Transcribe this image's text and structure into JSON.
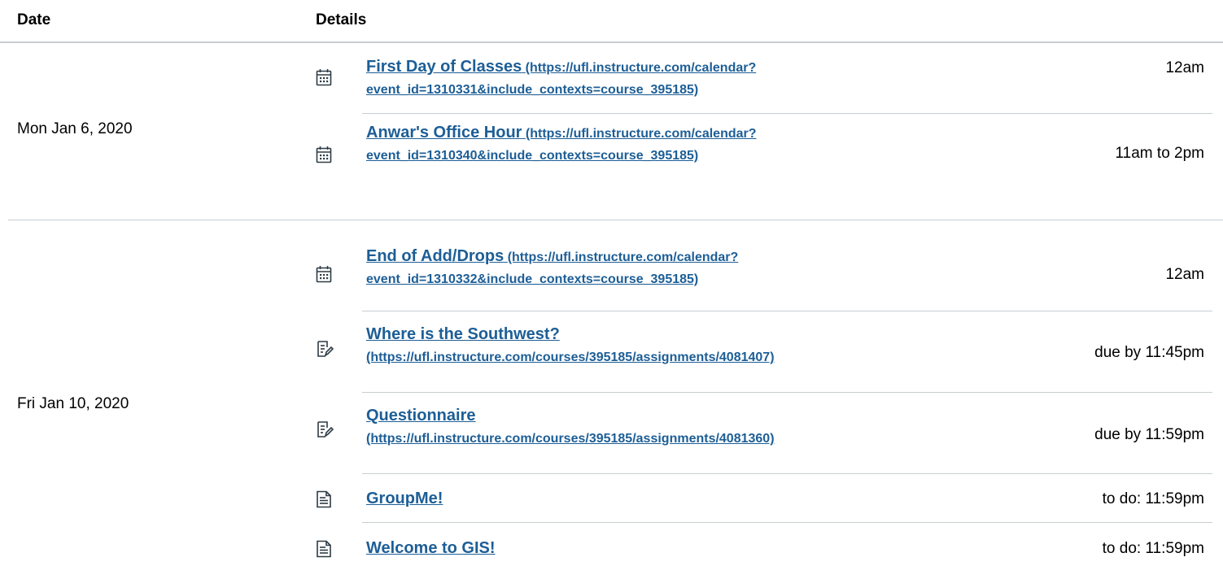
{
  "header": {
    "date_label": "Date",
    "details_label": "Details"
  },
  "groups": [
    {
      "date": "Mon Jan 6, 2020",
      "events": [
        {
          "icon": "calendar-icon",
          "title": "First Day of Classes",
          "url": "(https://ufl.instructure.com/calendar?event_id=1310331&include_contexts=course_395185)",
          "url_line1": "(https://ufl.instructure.com/calendar?",
          "url_line2": "event_id=1310331&include_contexts=course_395185)",
          "time": "12am"
        },
        {
          "icon": "calendar-icon",
          "title": "Anwar's Office Hour",
          "url_line1": "(https://ufl.instructure.com/calendar?",
          "url_line2": "event_id=1310340&include_contexts=course_395185)",
          "time": "11am to 2pm"
        }
      ]
    },
    {
      "date": "Fri Jan 10, 2020",
      "events": [
        {
          "icon": "calendar-icon",
          "title": "End of Add/Drops",
          "url_line1": "(https://ufl.instructure.com/calendar?",
          "url_line2": "event_id=1310332&include_contexts=course_395185)",
          "time": "12am"
        },
        {
          "icon": "assignment-icon",
          "title": "Where is the Southwest?",
          "url_line2": "(https://ufl.instructure.com/courses/395185/assignments/4081407)",
          "time": "due by 11:45pm"
        },
        {
          "icon": "assignment-icon",
          "title": "Questionnaire",
          "url_line2": "(https://ufl.instructure.com/courses/395185/assignments/4081360)",
          "time": "due by 11:59pm"
        },
        {
          "icon": "page-icon",
          "title": "GroupMe!",
          "time": "to do: 11:59pm"
        },
        {
          "icon": "page-icon",
          "title": "Welcome to GIS!",
          "time": "to do: 11:59pm"
        }
      ]
    }
  ]
}
